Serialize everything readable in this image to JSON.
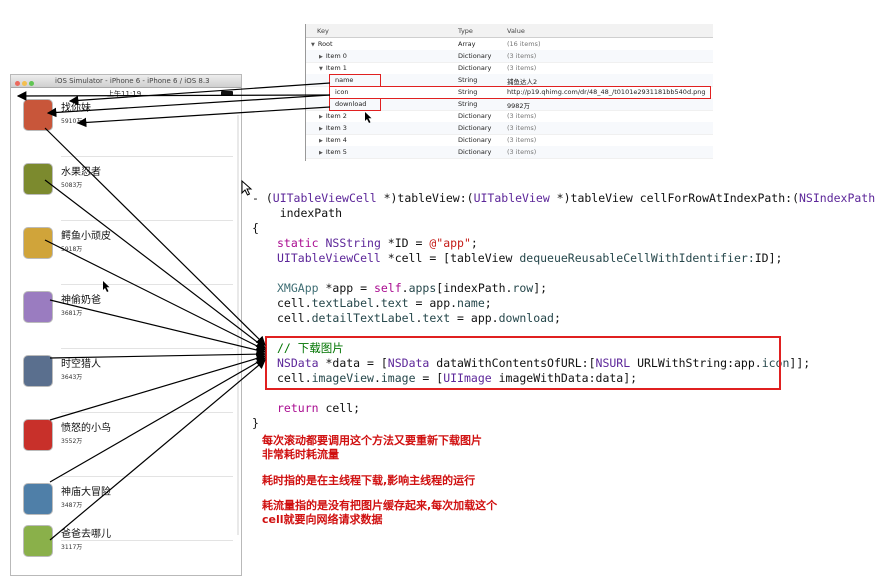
{
  "simulator": {
    "title": "iOS Simulator - iPhone 6 - iPhone 6 / iOS 8.3",
    "time": "上午11:19",
    "apps": [
      {
        "name": "找你妹",
        "download": "5910万",
        "color": "#c8563a"
      },
      {
        "name": "水果忍者",
        "download": "5083万",
        "color": "#7c8a2e"
      },
      {
        "name": "鳄鱼小顽皮",
        "download": "5918万",
        "color": "#d0a43a"
      },
      {
        "name": "神偷奶爸",
        "download": "3681万",
        "color": "#9a7cc0"
      },
      {
        "name": "时空猎人",
        "download": "3643万",
        "color": "#5a6f8e"
      },
      {
        "name": "愤怒的小鸟",
        "download": "3552万",
        "color": "#c8302a"
      },
      {
        "name": "神庙大冒险",
        "download": "3487万",
        "color": "#4f7fa8"
      },
      {
        "name": "爸爸去哪儿",
        "download": "3117万",
        "color": "#8ab04a"
      }
    ]
  },
  "plist": {
    "headers": {
      "key": "Key",
      "type": "Type",
      "value": "Value"
    },
    "rows": [
      {
        "key": "Root",
        "type": "Array",
        "value": "(16 items)"
      },
      {
        "key": "Item 0",
        "type": "Dictionary",
        "value": "(3 items)"
      },
      {
        "key": "Item 1",
        "type": "Dictionary",
        "value": "(3 items)"
      },
      {
        "key": "name",
        "type": "String",
        "value": "捕鱼达人2"
      },
      {
        "key": "icon",
        "type": "String",
        "value": "http://p19.qhimg.com/dr/48_48_/t0101e2931181bb540d.png"
      },
      {
        "key": "download",
        "type": "String",
        "value": "9982万"
      },
      {
        "key": "Item 2",
        "type": "Dictionary",
        "value": "(3 items)"
      },
      {
        "key": "Item 3",
        "type": "Dictionary",
        "value": "(3 items)"
      },
      {
        "key": "Item 4",
        "type": "Dictionary",
        "value": "(3 items)"
      },
      {
        "key": "Item 5",
        "type": "Dictionary",
        "value": "(3 items)"
      }
    ]
  },
  "code": {
    "line1_a": "- (",
    "line1_b": "UITableViewCell",
    "line1_c": " *)tableView:(",
    "line1_d": "UITableView",
    "line1_e": " *)tableView cellForRowAtIndexPath:(",
    "line1_f": "NSIndexPath",
    "line1_g": " *)",
    "line2": "    indexPath",
    "line3": "{",
    "line4_a": "static",
    "line4_b": "NSString",
    "line4_c": " *ID = ",
    "line4_d": "@\"app\"",
    "line4_e": ";",
    "line5_a": "UITableViewCell",
    "line5_b": " *cell = [tableView ",
    "line5_c": "dequeueReusableCellWithIdentifier:",
    "line5_d": "ID];",
    "line6_a": "XMGApp",
    "line6_b": " *app = ",
    "line6_c": "self",
    "line6_d": ".",
    "line6_e": "apps",
    "line6_f": "[indexPath.",
    "line6_g": "row",
    "line6_h": "];",
    "line7_a": "cell.",
    "line7_b": "textLabel",
    "line7_c": ".",
    "line7_d": "text",
    "line7_e": " = app.",
    "line7_f": "name",
    "line7_g": ";",
    "line8_a": "cell.",
    "line8_b": "detailTextLabel",
    "line8_c": ".",
    "line8_d": "text",
    "line8_e": " = app.",
    "line8_f": "download",
    "line8_g": ";",
    "comment": "// 下载图片",
    "line10_a": "NSData",
    "line10_b": " *data = [",
    "line10_c": "NSData",
    "line10_d": " dataWithContentsOfURL:[",
    "line10_e": "NSURL",
    "line10_f": " URLWithString:app.",
    "line10_g": "icon",
    "line10_h": "]];",
    "line11_a": "cell.",
    "line11_b": "imageView",
    "line11_c": ".",
    "line11_d": "image",
    "line11_e": " = [",
    "line11_f": "UIImage",
    "line11_g": " imageWithData:data];",
    "line12_a": "return",
    "line12_b": " cell;",
    "line13": "}"
  },
  "notes": {
    "n1": "每次滚动都要调用这个方法又要重新下载图片",
    "n2": "非常耗时耗流量",
    "n3": "耗时指的是在主线程下载,影响主线程的运行",
    "n4": "耗流量指的是没有把图片缓存起来,每次加载这个",
    "n5": "cell就要向网络请求数据"
  },
  "colors": {
    "annotation_red": "#e02020",
    "note_red": "#d01010"
  }
}
